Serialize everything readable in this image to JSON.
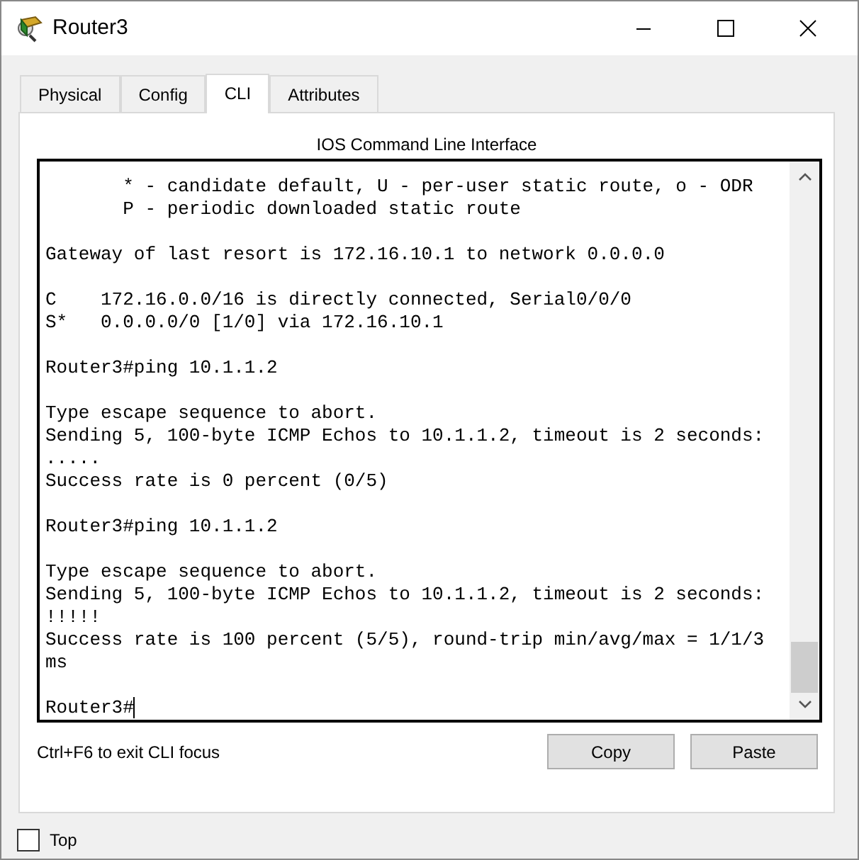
{
  "window": {
    "title": "Router3"
  },
  "tabs": [
    {
      "label": "Physical",
      "selected": false
    },
    {
      "label": "Config",
      "selected": false
    },
    {
      "label": "CLI",
      "selected": true
    },
    {
      "label": "Attributes",
      "selected": false
    }
  ],
  "heading": "IOS Command Line Interface",
  "terminal": {
    "groups": [
      [
        "       * - candidate default, U - per-user static route, o - ODR",
        "       P - periodic downloaded static route"
      ],
      [
        "Gateway of last resort is 172.16.10.1 to network 0.0.0.0"
      ],
      [
        "C    172.16.0.0/16 is directly connected, Serial0/0/0",
        "S*   0.0.0.0/0 [1/0] via 172.16.10.1"
      ],
      [
        "Router3#ping 10.1.1.2"
      ],
      [
        "Type escape sequence to abort.",
        "Sending 5, 100-byte ICMP Echos to 10.1.1.2, timeout is 2 seconds:",
        ".....",
        "Success rate is 0 percent (0/5)"
      ],
      [
        "Router3#ping 10.1.1.2"
      ],
      [
        "Type escape sequence to abort.",
        "Sending 5, 100-byte ICMP Echos to 10.1.1.2, timeout is 2 seconds:",
        "!!!!!",
        "Success rate is 100 percent (5/5), round-trip min/avg/max = 1/1/3",
        "ms"
      ]
    ],
    "prompt": "Router3#"
  },
  "hint": "Ctrl+F6 to exit CLI focus",
  "buttons": [
    "Copy",
    "Paste"
  ],
  "top_checkbox": {
    "label": "Top",
    "checked": false
  }
}
